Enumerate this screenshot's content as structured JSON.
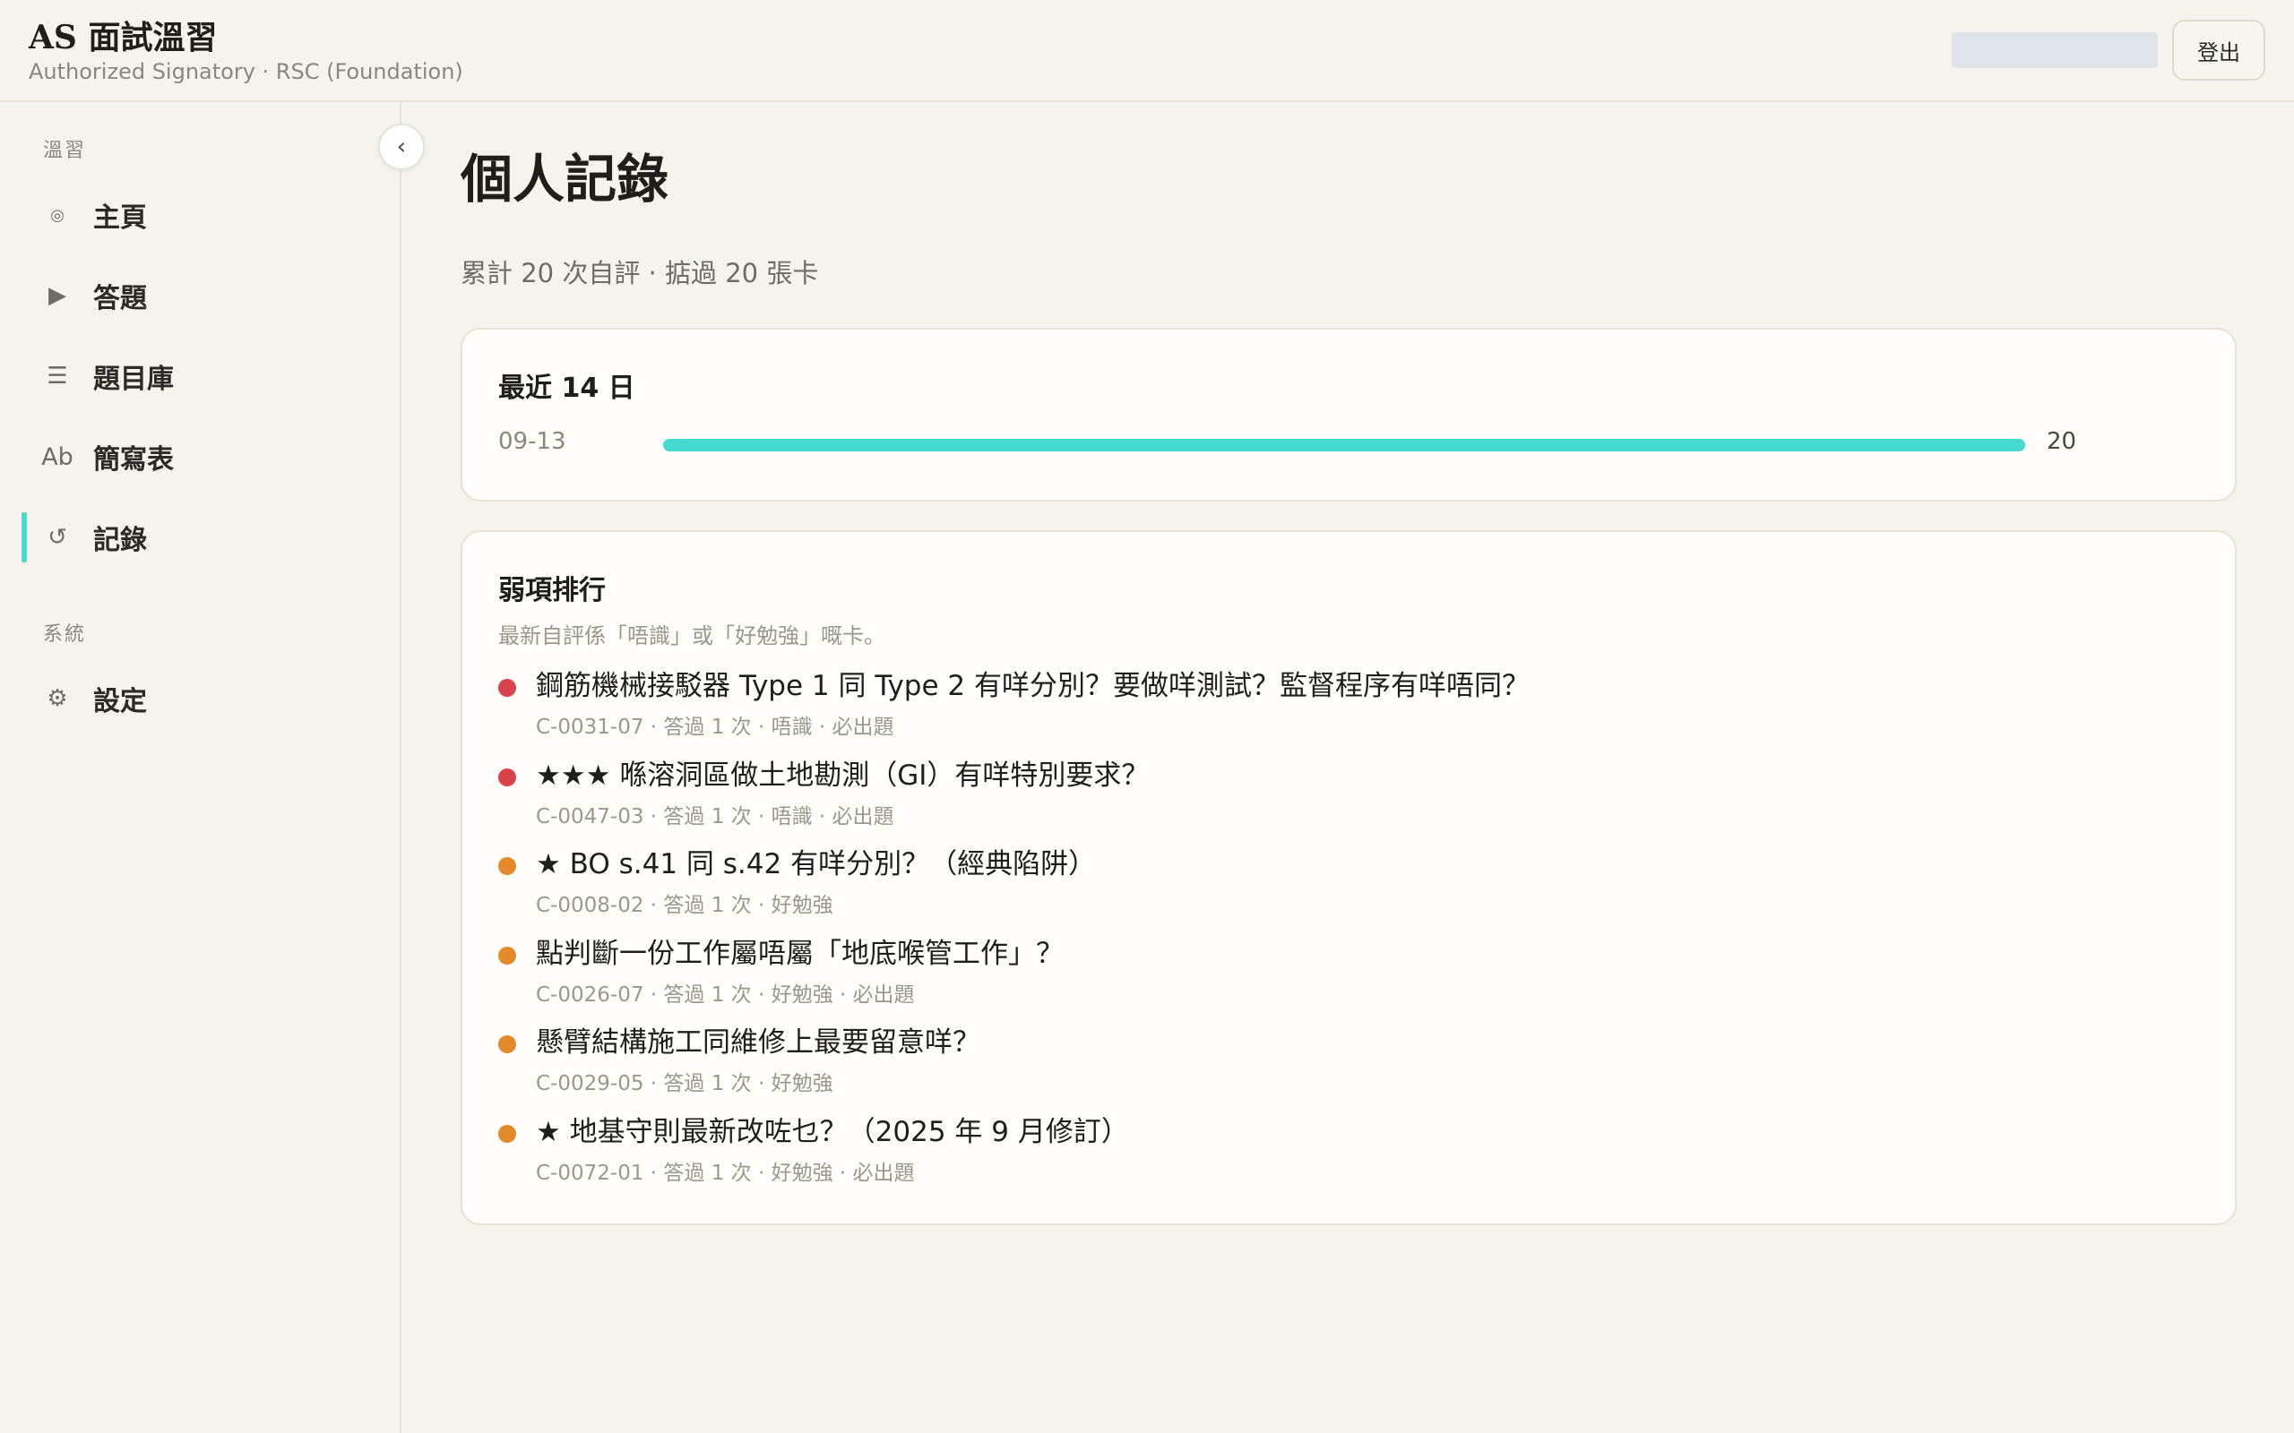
{
  "header": {
    "title": "AS 面試溫習",
    "subtitle": "Authorized Signatory · RSC (Foundation)",
    "logout_label": "登出"
  },
  "sidebar": {
    "section_study": "溫習",
    "section_system": "系統",
    "collapse_icon": "‹",
    "items": [
      {
        "label": "主頁",
        "icon": "◎"
      },
      {
        "label": "答題",
        "icon": "▶"
      },
      {
        "label": "題目庫",
        "icon": "☰"
      },
      {
        "label": "簡寫表",
        "icon": "Ab"
      },
      {
        "label": "記錄",
        "icon": "↺"
      },
      {
        "label": "設定",
        "icon": "⚙"
      }
    ]
  },
  "page": {
    "title": "個人記錄",
    "summary": "累計 20 次自評 · 掂過 20 張卡"
  },
  "recent": {
    "title": "最近 14 日",
    "accent_color": "#46d9cf",
    "rows": [
      {
        "date": "09-13",
        "count": "20",
        "fraction": 1.0
      }
    ]
  },
  "weak": {
    "title": "弱項排行",
    "description": "最新自評係「唔識」或「好勉強」嘅卡。",
    "colors": {
      "red": "#d9434b",
      "orange": "#e58a2a"
    },
    "items": [
      {
        "question": "鋼筋機械接駁器 Type 1 同 Type 2 有咩分別？要做咩測試？監督程序有咩唔同？",
        "meta": "C-0031-07 · 答過 1 次 · 唔識 · 必出題",
        "level": "red"
      },
      {
        "question": "★★★ 喺溶洞區做土地勘測（GI）有咩特別要求？",
        "meta": "C-0047-03 · 答過 1 次 · 唔識 · 必出題",
        "level": "red"
      },
      {
        "question": "★ BO s.41 同 s.42 有咩分別？（經典陷阱）",
        "meta": "C-0008-02 · 答過 1 次 · 好勉強",
        "level": "orange"
      },
      {
        "question": "點判斷一份工作屬唔屬「地底喉管工作」？",
        "meta": "C-0026-07 · 答過 1 次 · 好勉強 · 必出題",
        "level": "orange"
      },
      {
        "question": "懸臂結構施工同維修上最要留意咩？",
        "meta": "C-0029-05 · 答過 1 次 · 好勉強",
        "level": "orange"
      },
      {
        "question": "★ 地基守則最新改咗乜？（2025 年 9 月修訂）",
        "meta": "C-0072-01 · 答過 1 次 · 好勉強 · 必出題",
        "level": "orange"
      }
    ]
  }
}
